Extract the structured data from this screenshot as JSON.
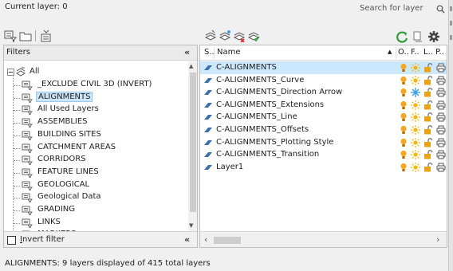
{
  "header": {
    "current_layer": "Current layer: 0",
    "search_placeholder": "Search for layer"
  },
  "filters": {
    "title": "Filters",
    "collapse_glyph": "«",
    "root": "All",
    "items": [
      "_EXCLUDE CIVIL 3D (INVERT)",
      "ALIGNMENTS",
      "All Used Layers",
      "ASSEMBLIES",
      "BUILDING SITES",
      "CATCHMENT AREAS",
      "CORRIDORS",
      "FEATURE LINES",
      "GEOLOGICAL",
      "Geological Data",
      "GRADING",
      "LINKS",
      "MARKERS"
    ],
    "selected": "ALIGNMENTS",
    "invert_filter_prefix": "I",
    "invert_filter_rest": "nvert filter",
    "invert_checked": false
  },
  "layers": {
    "columns": {
      "status": "S..",
      "name": "Name",
      "on": "O..",
      "freeze": "F..",
      "lock": "L..",
      "plot": "P.."
    },
    "rows": [
      {
        "name": "C-ALIGNMENTS",
        "selected": true,
        "frozen_viewport": false
      },
      {
        "name": "C-ALIGNMENTS_Curve",
        "selected": false,
        "frozen_viewport": false
      },
      {
        "name": "C-ALIGNMENTS_Direction Arrow",
        "selected": false,
        "frozen_viewport": true
      },
      {
        "name": "C-ALIGNMENTS_Extensions",
        "selected": false,
        "frozen_viewport": false
      },
      {
        "name": "C-ALIGNMENTS_Line",
        "selected": false,
        "frozen_viewport": false
      },
      {
        "name": "C-ALIGNMENTS_Offsets",
        "selected": false,
        "frozen_viewport": false
      },
      {
        "name": "C-ALIGNMENTS_Plotting Style",
        "selected": false,
        "frozen_viewport": false
      },
      {
        "name": "C-ALIGNMENTS_Transition",
        "selected": false,
        "frozen_viewport": false
      },
      {
        "name": "Layer1",
        "selected": false,
        "frozen_viewport": false
      }
    ]
  },
  "status_bar": {
    "text": "ALIGNMENTS: 9 layers displayed of 415 total layers"
  },
  "icons": {
    "toolbar_left": [
      "new-property-filter-icon",
      "new-group-filter-icon",
      "layer-states-manager-icon"
    ],
    "toolbar_mid": [
      "new-layer-icon",
      "new-layer-vp-frozen-icon",
      "delete-layer-icon",
      "set-current-icon"
    ],
    "toolbar_right": [
      "refresh-icon",
      "settings-toggle-icon",
      "gear-icon"
    ]
  },
  "colors": {
    "selection": "#cce8ff",
    "tree_selection": "#cce4f7",
    "bulb": "#f5a623",
    "sun": "#f2b705",
    "freeze_blue": "#3aa0e6",
    "lock": "#e8a317",
    "refresh_green": "#2e9b3a"
  }
}
